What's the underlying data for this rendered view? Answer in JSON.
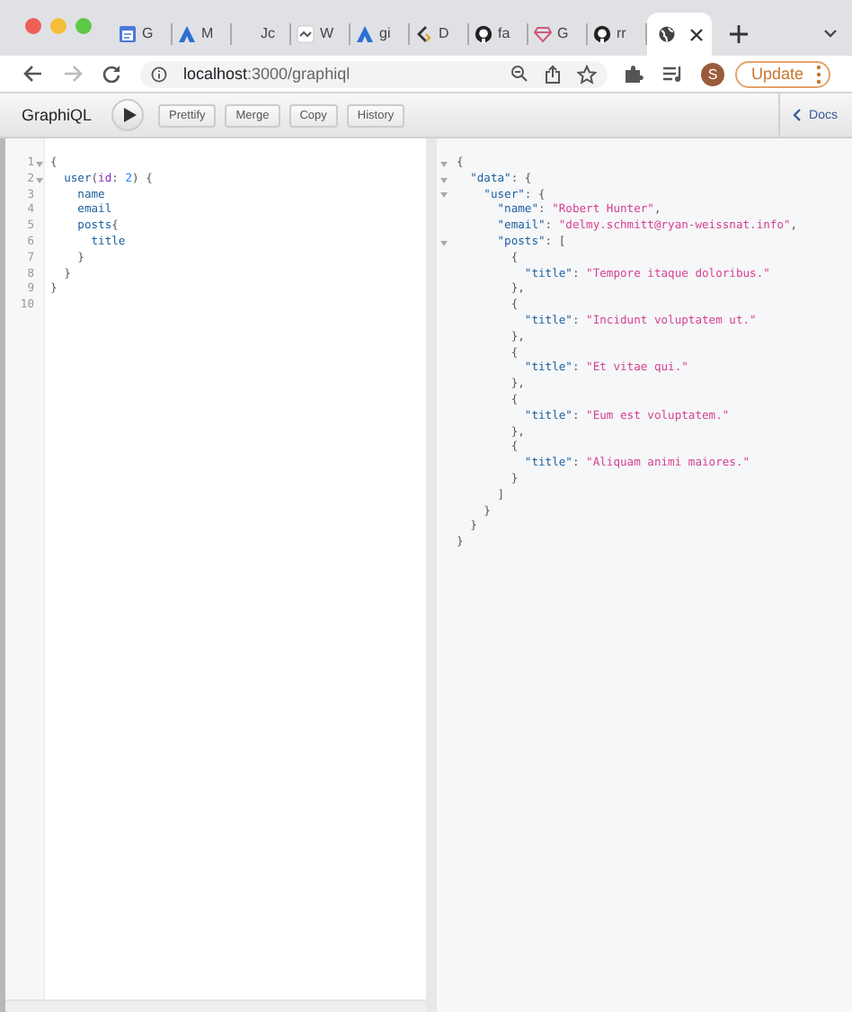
{
  "browser": {
    "tabs": [
      {
        "label": "G",
        "kind": "calendar",
        "selected": false
      },
      {
        "label": "M",
        "kind": "peak",
        "selected": false
      },
      {
        "label": "Jc",
        "kind": "none",
        "selected": false
      },
      {
        "label": "W",
        "kind": "wave",
        "selected": false
      },
      {
        "label": "gi",
        "kind": "peak",
        "selected": false
      },
      {
        "label": "D",
        "kind": "swirl",
        "selected": false
      },
      {
        "label": "fa",
        "kind": "octo",
        "selected": false
      },
      {
        "label": "G",
        "kind": "gem",
        "selected": false
      },
      {
        "label": "rr",
        "kind": "octo",
        "selected": false
      },
      {
        "kind": "globe",
        "selected": true
      }
    ],
    "url": "**localhost**:3000/graphiql",
    "profile": "S",
    "update": "Update"
  },
  "graphiql": {
    "title": "GraphiQL",
    "buttons": [
      "Prettify",
      "Merge",
      "Copy",
      "History"
    ],
    "docs": "Docs",
    "query": [
      {
        "number": "1",
        "fold": true,
        "tokens": [
          {
            "text": "{",
            "kind": "punct"
          }
        ]
      },
      {
        "number": "2",
        "fold": true,
        "tokens": [
          {
            "text": "  user",
            "kind": "field"
          },
          {
            "text": "(",
            "kind": "punct"
          },
          {
            "text": "id",
            "kind": "arg"
          },
          {
            "text": ": ",
            "kind": "punct"
          },
          {
            "text": "2",
            "kind": "number"
          },
          {
            "text": ") {",
            "kind": "punct"
          }
        ]
      },
      {
        "number": "3",
        "fold": false,
        "tokens": [
          {
            "text": "    name",
            "kind": "field"
          }
        ]
      },
      {
        "number": "4",
        "fold": false,
        "tokens": [
          {
            "text": "    email",
            "kind": "field"
          }
        ]
      },
      {
        "number": "5",
        "fold": false,
        "tokens": [
          {
            "text": "    posts",
            "kind": "field"
          },
          {
            "text": "{",
            "kind": "punct"
          }
        ]
      },
      {
        "number": "6",
        "fold": false,
        "tokens": [
          {
            "text": "      title",
            "kind": "field"
          }
        ]
      },
      {
        "number": "7",
        "fold": false,
        "tokens": [
          {
            "text": "    }",
            "kind": "punct"
          }
        ]
      },
      {
        "number": "8",
        "fold": false,
        "tokens": [
          {
            "text": "  }",
            "kind": "punct"
          }
        ]
      },
      {
        "number": "9",
        "fold": false,
        "tokens": [
          {
            "text": "}",
            "kind": "punct"
          }
        ]
      },
      {
        "number": "10",
        "fold": false
      }
    ],
    "result": [
      {
        "fold": true,
        "tokens": [
          {
            "text": "{",
            "kind": "punct"
          }
        ]
      },
      {
        "fold": true,
        "tokens": [
          {
            "text": "  \"data\"",
            "kind": "key"
          },
          {
            "text": ": {",
            "kind": "punct"
          }
        ]
      },
      {
        "fold": true,
        "tokens": [
          {
            "text": "    \"user\"",
            "kind": "key"
          },
          {
            "text": ": {",
            "kind": "punct"
          }
        ]
      },
      {
        "fold": false,
        "tokens": [
          {
            "text": "      \"name\"",
            "kind": "key"
          },
          {
            "text": ": ",
            "kind": "punct"
          },
          {
            "text": "\"Robert Hunter\"",
            "kind": "string"
          },
          {
            "text": ",",
            "kind": "punct"
          }
        ]
      },
      {
        "fold": false,
        "tokens": [
          {
            "text": "      \"email\"",
            "kind": "key"
          },
          {
            "text": ": ",
            "kind": "punct"
          },
          {
            "text": "\"delmy.schmitt@ryan-weissnat.info\"",
            "kind": "string"
          },
          {
            "text": ",",
            "kind": "punct"
          }
        ]
      },
      {
        "fold": true,
        "tokens": [
          {
            "text": "      \"posts\"",
            "kind": "key"
          },
          {
            "text": ": [",
            "kind": "punct"
          }
        ]
      },
      {
        "fold": false,
        "tokens": [
          {
            "text": "        {",
            "kind": "punct"
          }
        ]
      },
      {
        "fold": false,
        "tokens": [
          {
            "text": "          \"title\"",
            "kind": "key"
          },
          {
            "text": ": ",
            "kind": "punct"
          },
          {
            "text": "\"Tempore itaque doloribus.\"",
            "kind": "string"
          }
        ]
      },
      {
        "fold": false,
        "tokens": [
          {
            "text": "        },",
            "kind": "punct"
          }
        ]
      },
      {
        "fold": false,
        "tokens": [
          {
            "text": "        {",
            "kind": "punct"
          }
        ]
      },
      {
        "fold": false,
        "tokens": [
          {
            "text": "          \"title\"",
            "kind": "key"
          },
          {
            "text": ": ",
            "kind": "punct"
          },
          {
            "text": "\"Incidunt voluptatem ut.\"",
            "kind": "string"
          }
        ]
      },
      {
        "fold": false,
        "tokens": [
          {
            "text": "        },",
            "kind": "punct"
          }
        ]
      },
      {
        "fold": false,
        "tokens": [
          {
            "text": "        {",
            "kind": "punct"
          }
        ]
      },
      {
        "fold": false,
        "tokens": [
          {
            "text": "          \"title\"",
            "kind": "key"
          },
          {
            "text": ": ",
            "kind": "punct"
          },
          {
            "text": "\"Et vitae qui.\"",
            "kind": "string"
          }
        ]
      },
      {
        "fold": false,
        "tokens": [
          {
            "text": "        },",
            "kind": "punct"
          }
        ]
      },
      {
        "fold": false,
        "tokens": [
          {
            "text": "        {",
            "kind": "punct"
          }
        ]
      },
      {
        "fold": false,
        "tokens": [
          {
            "text": "          \"title\"",
            "kind": "key"
          },
          {
            "text": ": ",
            "kind": "punct"
          },
          {
            "text": "\"Eum est voluptatem.\"",
            "kind": "string"
          }
        ]
      },
      {
        "fold": false,
        "tokens": [
          {
            "text": "        },",
            "kind": "punct"
          }
        ]
      },
      {
        "fold": false,
        "tokens": [
          {
            "text": "        {",
            "kind": "punct"
          }
        ]
      },
      {
        "fold": false,
        "tokens": [
          {
            "text": "          \"title\"",
            "kind": "key"
          },
          {
            "text": ": ",
            "kind": "punct"
          },
          {
            "text": "\"Aliquam animi maiores.\"",
            "kind": "string"
          }
        ]
      },
      {
        "fold": false,
        "tokens": [
          {
            "text": "        }",
            "kind": "punct"
          }
        ]
      },
      {
        "fold": false,
        "tokens": [
          {
            "text": "      ]",
            "kind": "punct"
          }
        ]
      },
      {
        "fold": false,
        "tokens": [
          {
            "text": "    }",
            "kind": "punct"
          }
        ]
      },
      {
        "fold": false,
        "tokens": [
          {
            "text": "  }",
            "kind": "punct"
          }
        ]
      },
      {
        "fold": false,
        "tokens": [
          {
            "text": "}",
            "kind": "punct"
          }
        ]
      }
    ]
  }
}
